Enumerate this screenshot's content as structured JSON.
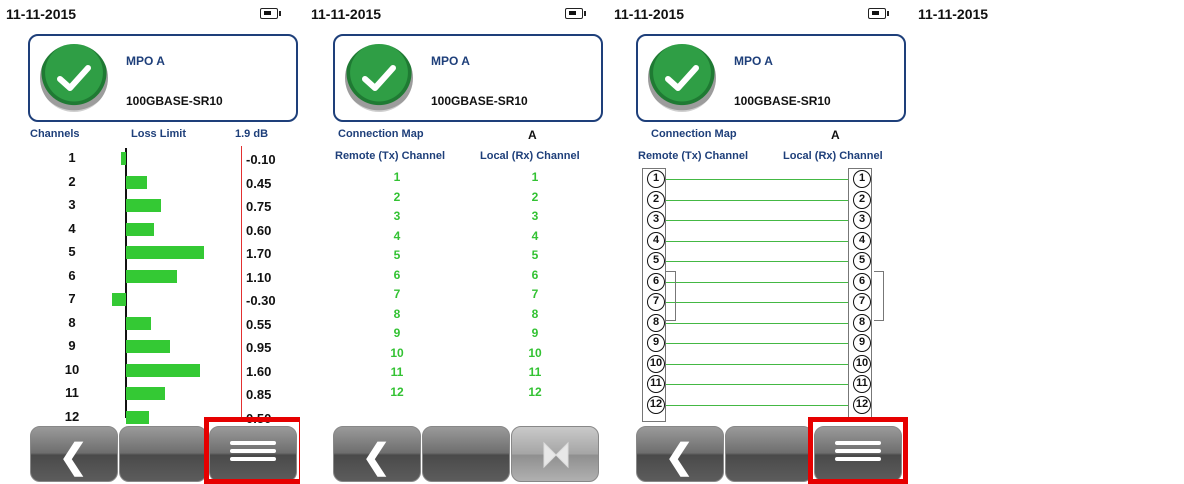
{
  "screens": [
    {
      "date": "11-11-2015",
      "result": {
        "title": "MPO A",
        "standard": "100GBASE-SR10"
      },
      "headers": {
        "channels": "Channels",
        "loss_limit": "Loss Limit",
        "limit_value": "1.9 dB"
      },
      "rows": [
        {
          "ch": "1",
          "v": "-0.10",
          "loss": -0.1
        },
        {
          "ch": "2",
          "v": "0.45",
          "loss": 0.45
        },
        {
          "ch": "3",
          "v": "0.75",
          "loss": 0.75
        },
        {
          "ch": "4",
          "v": "0.60",
          "loss": 0.6
        },
        {
          "ch": "5",
          "v": "1.70",
          "loss": 1.7
        },
        {
          "ch": "6",
          "v": "1.10",
          "loss": 1.1
        },
        {
          "ch": "7",
          "v": "-0.30",
          "loss": -0.3
        },
        {
          "ch": "8",
          "v": "0.55",
          "loss": 0.55
        },
        {
          "ch": "9",
          "v": "0.95",
          "loss": 0.95
        },
        {
          "ch": "10",
          "v": "1.60",
          "loss": 1.6
        },
        {
          "ch": "11",
          "v": "0.85",
          "loss": 0.85
        },
        {
          "ch": "12",
          "v": "0.50",
          "loss": 0.5
        }
      ],
      "softkeys": [
        "back",
        "",
        "menu"
      ]
    },
    {
      "date": "11-11-2015",
      "result": {
        "title": "MPO A",
        "standard": "100GBASE-SR10"
      },
      "map": {
        "label": "Connection Map",
        "value": "A",
        "remote": "Remote (Tx) Channel",
        "local": "Local (Rx) Channel"
      },
      "pairs": [
        [
          "1",
          "1"
        ],
        [
          "2",
          "2"
        ],
        [
          "3",
          "3"
        ],
        [
          "4",
          "4"
        ],
        [
          "5",
          "5"
        ],
        [
          "6",
          "6"
        ],
        [
          "7",
          "7"
        ],
        [
          "8",
          "8"
        ],
        [
          "9",
          "9"
        ],
        [
          "10",
          "10"
        ],
        [
          "11",
          "11"
        ],
        [
          "12",
          "12"
        ]
      ],
      "softkeys": [
        "back",
        "",
        "swap"
      ]
    },
    {
      "date": "11-11-2015",
      "result": {
        "title": "MPO A",
        "standard": "100GBASE-SR10"
      },
      "map": {
        "label": "Connection Map",
        "value": "A",
        "remote": "Remote (Tx) Channel",
        "local": "Local (Rx) Channel"
      },
      "nodes": [
        "1",
        "2",
        "3",
        "4",
        "5",
        "6",
        "7",
        "8",
        "9",
        "10",
        "11",
        "12"
      ],
      "softkeys": [
        "back",
        "",
        "menu"
      ]
    },
    {
      "date": "11-11-2015"
    }
  ],
  "colors": {
    "pass": "#2f9e45",
    "bar": "#34c934",
    "limit": "#e23030",
    "highlight": "#e60000",
    "header": "#1e3f7a"
  },
  "icons": [
    "check-icon",
    "battery-icon",
    "back-chevron-icon",
    "menu-list-icon",
    "swap-icon"
  ]
}
